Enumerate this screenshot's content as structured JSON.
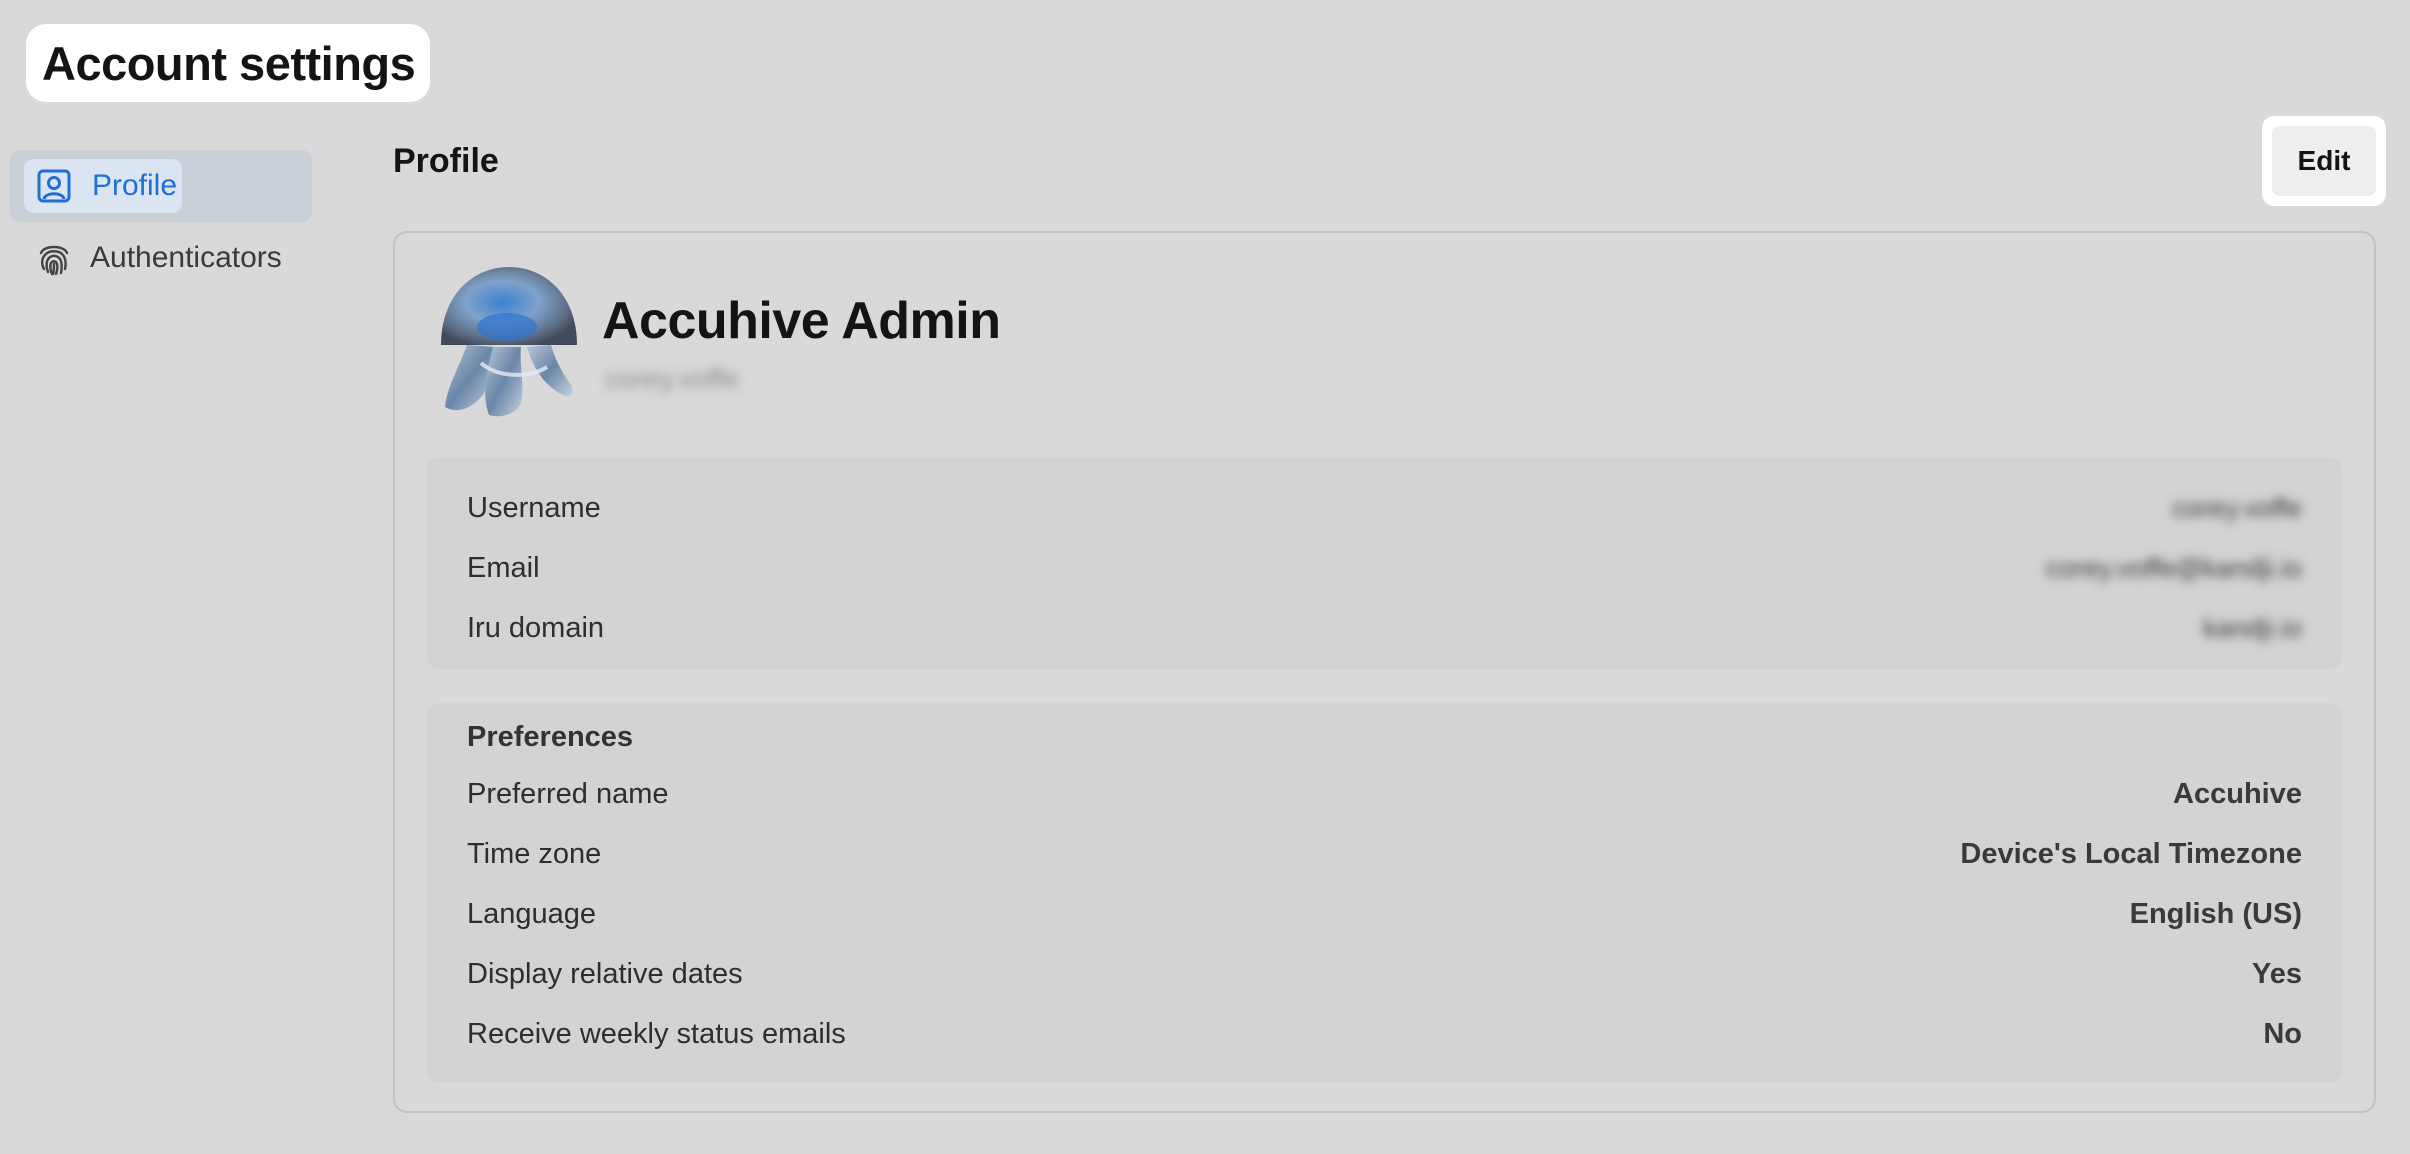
{
  "page": {
    "title": "Account settings"
  },
  "sidebar": {
    "items": [
      {
        "label": "Profile",
        "icon": "profile-icon",
        "active": true
      },
      {
        "label": "Authenticators",
        "icon": "fingerprint-icon",
        "active": false
      }
    ]
  },
  "section": {
    "title": "Profile",
    "edit_label": "Edit"
  },
  "profile": {
    "display_name": "Accuhive Admin",
    "handle": "corey.voffe"
  },
  "account_info": {
    "rows": [
      {
        "label": "Username",
        "value": "corey.voffe"
      },
      {
        "label": "Email",
        "value": "corey.voffe@kandji.io"
      },
      {
        "label": "Iru domain",
        "value": "kandji.io"
      }
    ]
  },
  "preferences": {
    "heading": "Preferences",
    "rows": [
      {
        "label": "Preferred name",
        "value": "Accuhive"
      },
      {
        "label": "Time zone",
        "value": "Device's Local Timezone"
      },
      {
        "label": "Language",
        "value": "English (US)"
      },
      {
        "label": "Display relative dates",
        "value": "Yes"
      },
      {
        "label": "Receive weekly status emails",
        "value": "No"
      }
    ]
  },
  "colors": {
    "background": "#d9d9d9",
    "accent": "#1f6fd6",
    "active_nav_bg": "#c9d0d8",
    "panel_bg": "#d3d3d3"
  }
}
